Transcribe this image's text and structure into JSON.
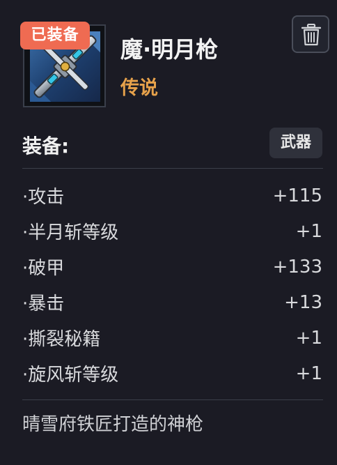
{
  "item": {
    "badge": "已装备",
    "name": "魔·明月枪",
    "rarity": "传说",
    "rarity_color": "#e7a24b",
    "icon": "spear-weapon-icon"
  },
  "actions": {
    "delete_icon": "trash-icon"
  },
  "section": {
    "label": "装备:",
    "type_tag": "武器"
  },
  "stats": [
    {
      "label": "·攻击",
      "value": "+115"
    },
    {
      "label": "·半月斩等级",
      "value": "+1"
    },
    {
      "label": "·破甲",
      "value": "+133"
    },
    {
      "label": "·暴击",
      "value": "+13"
    },
    {
      "label": "·撕裂秘籍",
      "value": "+1"
    },
    {
      "label": "·旋风斩等级",
      "value": "+1"
    }
  ],
  "description": "晴雪府铁匠打造的神枪",
  "colors": {
    "background": "#1b1b24",
    "badge": "#ef6b52",
    "tag_background": "#2f313b"
  }
}
